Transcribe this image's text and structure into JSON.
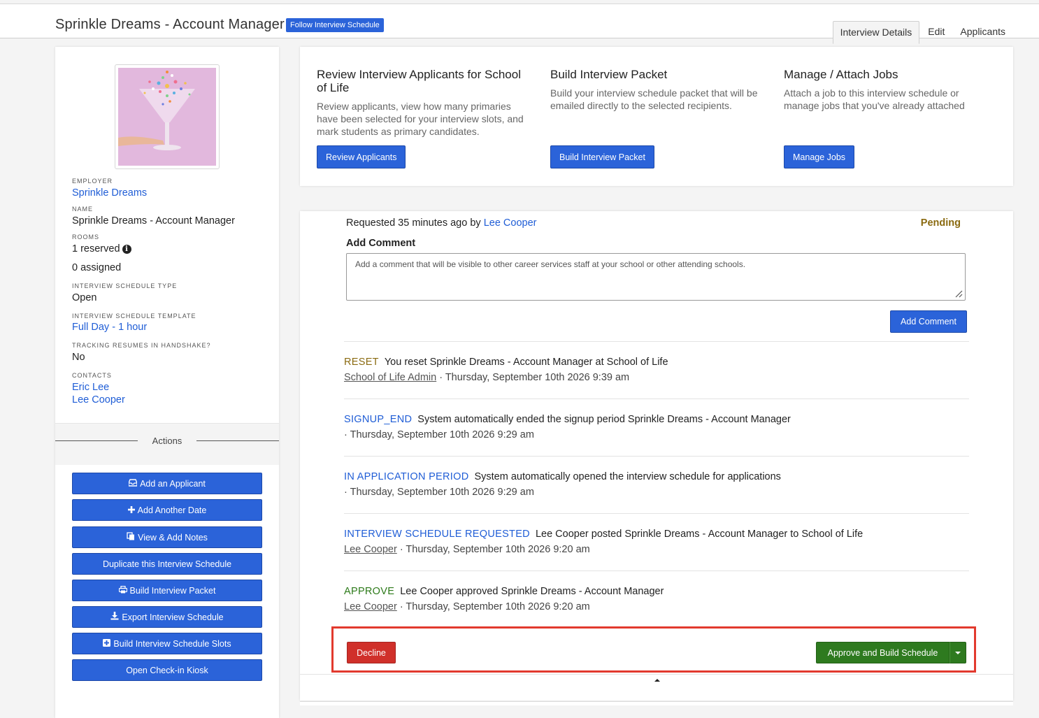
{
  "header": {
    "title": "Sprinkle Dreams - Account Manager",
    "status_pill": "Follow Interview Schedule",
    "tabs": [
      "Interview Details",
      "Edit",
      "Applicants"
    ]
  },
  "sidebar": {
    "employer_label": "EMPLOYER",
    "employer": "Sprinkle Dreams",
    "name_label": "NAME",
    "name": "Sprinkle Dreams - Account Manager",
    "rooms_label": "ROOMS",
    "rooms_reserved": "1 reserved",
    "rooms_assigned": "0 assigned",
    "type_label": "INTERVIEW SCHEDULE TYPE",
    "type": "Open",
    "template_label": "INTERVIEW SCHEDULE TEMPLATE",
    "template": "Full Day - 1 hour",
    "tracking_label": "TRACKING RESUMES IN HANDSHAKE?",
    "tracking": "No",
    "contacts_label": "CONTACTS",
    "contacts": [
      "Eric Lee",
      "Lee Cooper"
    ],
    "actions_title": "Actions",
    "actions": [
      {
        "label": "Add an Applicant",
        "icon": "inbox-icon"
      },
      {
        "label": "Add Another Date",
        "icon": "plus-icon"
      },
      {
        "label": "View & Add Notes",
        "icon": "copy-icon"
      },
      {
        "label": "Duplicate this Interview Schedule",
        "icon": ""
      },
      {
        "label": "Build Interview Packet",
        "icon": "print-icon"
      },
      {
        "label": "Export Interview Schedule",
        "icon": "download-icon"
      },
      {
        "label": "Build Interview Schedule Slots",
        "icon": "plus-square-icon"
      },
      {
        "label": "Open Check-in Kiosk",
        "icon": ""
      }
    ]
  },
  "features": [
    {
      "title": "Review Interview Applicants for School of Life",
      "desc": "Review applicants, view how many primaries have been selected for your interview slots, and mark students as primary candidates.",
      "button": "Review Applicants"
    },
    {
      "title": "Build Interview Packet",
      "desc": "Build your interview schedule packet that will be emailed directly to the selected recipients.",
      "button": "Build Interview Packet"
    },
    {
      "title": "Manage / Attach Jobs",
      "desc": "Attach a job to this interview schedule or manage jobs that you've already attached",
      "button": "Manage Jobs"
    }
  ],
  "request": {
    "prefix": "Requested 35 minutes ago by",
    "by": "Lee Cooper",
    "status": "Pending",
    "add_comment_label": "Add Comment",
    "comment_placeholder": "Add a comment that will be visible to other career services staff at your school or other attending schools.",
    "add_comment_button": "Add Comment"
  },
  "events": [
    {
      "kind": "RESET",
      "text": "You reset Sprinkle Dreams - Account Manager at School of Life",
      "author": "School of Life Admin",
      "time": "· Thursday, September 10th 2026 9:39 am"
    },
    {
      "kind": "SIGNUP_END",
      "text": "System automatically ended the signup period Sprinkle Dreams - Account Manager",
      "author": "",
      "time": "· Thursday, September 10th 2026 9:29 am"
    },
    {
      "kind": "IN APPLICATION PERIOD",
      "text": "System automatically opened the interview schedule for applications",
      "author": "",
      "time": "· Thursday, September 10th 2026 9:29 am"
    },
    {
      "kind": "INTERVIEW SCHEDULE REQUESTED",
      "text": "Lee Cooper posted Sprinkle Dreams - Account Manager to School of Life",
      "author": "Lee Cooper",
      "time": "· Thursday, September 10th 2026 9:20 am"
    },
    {
      "kind": "APPROVE",
      "text": "Lee Cooper approved Sprinkle Dreams - Account Manager",
      "author": "Lee Cooper",
      "time": "· Thursday, September 10th 2026 9:20 am"
    }
  ],
  "decision": {
    "decline": "Decline",
    "approve": "Approve and Build Schedule"
  },
  "colors": {
    "primary": "#2b63d9",
    "danger": "#d0302a",
    "success": "#2e7a1f",
    "pending": "#8a6a10",
    "highlight": "#e23a2e"
  }
}
